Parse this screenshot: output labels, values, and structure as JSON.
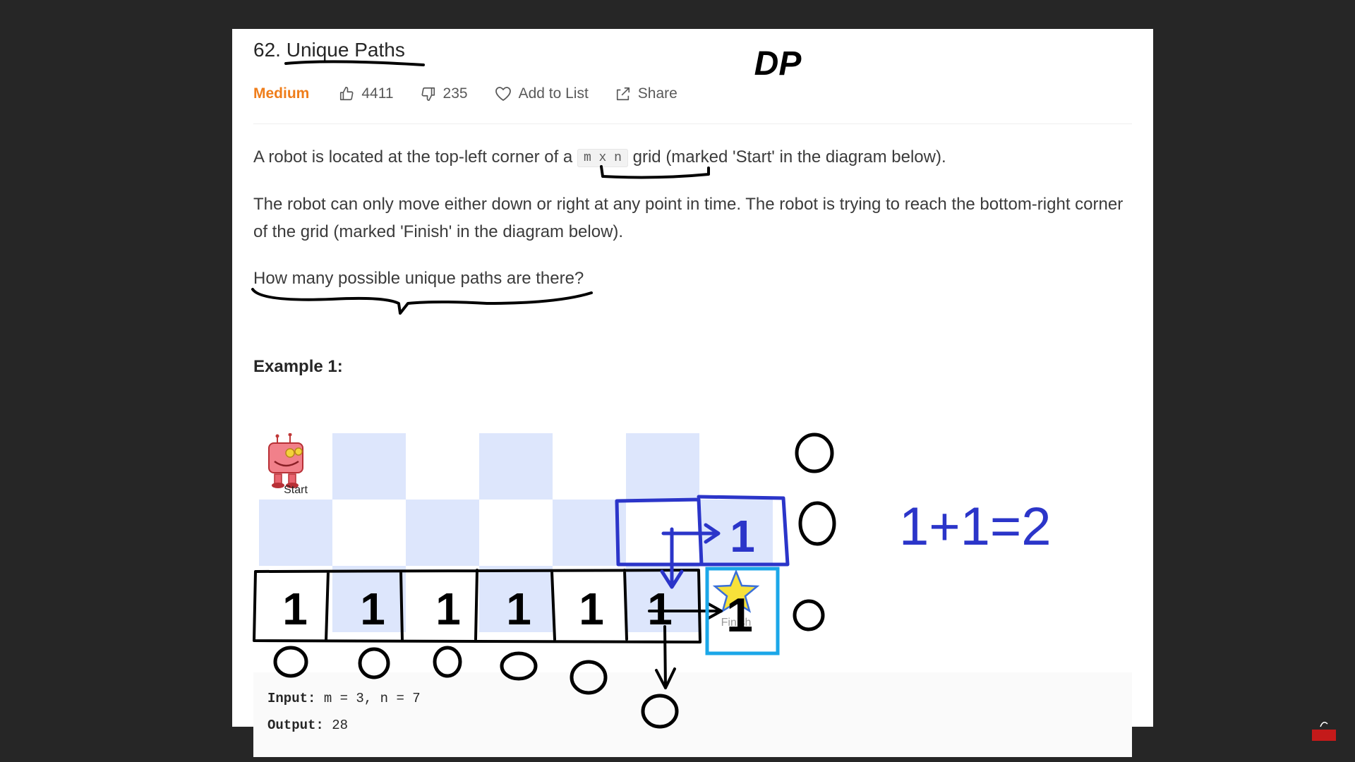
{
  "problem": {
    "number": "62.",
    "title": "Unique Paths",
    "difficulty": "Medium",
    "likes": "4411",
    "dislikes": "235",
    "add_to_list": "Add to List",
    "share": "Share"
  },
  "description": {
    "p1_before": "A robot is located at the top-left corner of a",
    "p1_code": "m x n",
    "p1_after": "grid (marked 'Start' in the diagram below).",
    "p2": "The robot can only move either down or right at any point in time. The robot is trying to reach the bottom-right corner of the grid (marked 'Finish' in the diagram below).",
    "p3": "How many possible unique paths are there?"
  },
  "example": {
    "heading": "Example 1:",
    "start_label": "Start",
    "finish_label": "Finish",
    "input_label": "Input:",
    "input_value": "m = 3, n = 7",
    "output_label": "Output:",
    "output_value": "28"
  },
  "annotations": {
    "dp": "DP",
    "bottom_row_values": [
      "1",
      "1",
      "1",
      "1",
      "1",
      "1",
      "1"
    ],
    "middle_cell_value": "1",
    "column_zeros": [
      "0",
      "0",
      "0"
    ],
    "row_zeros": [
      "0",
      "0",
      "0",
      "0",
      "0",
      "0"
    ],
    "equation": "1+1=2"
  },
  "colors": {
    "background": "#262626",
    "panel": "#ffffff",
    "difficulty": "#ef7d1a",
    "grid_light": "#dde6fc",
    "ink_black": "#000000",
    "ink_blue": "#2b35c9",
    "ink_cyan": "#1ba7e8"
  }
}
